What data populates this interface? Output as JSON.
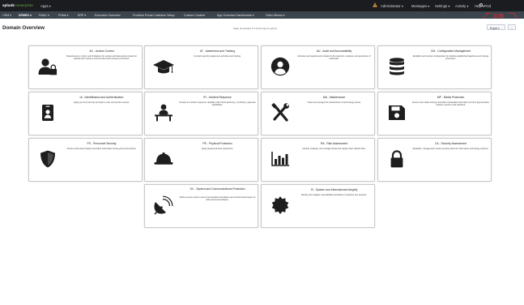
{
  "topbar": {
    "brand": "splunk",
    "brand_sub": ">enterprise",
    "apps": "Apps ▾",
    "administrator": "Administrator ▾",
    "messages": "Messages ▾",
    "settings": "Settings ▾",
    "activity": "Activity ▾",
    "help": "Help ▾",
    "find": "Find"
  },
  "nav": {
    "items": [
      "CRM ▾",
      "DPMRC ▾",
      "FAMC ▾",
      "FDMs ▾",
      "ERP ▾",
      "Executive Overview",
      "Frontline Portal Collection Setup",
      "Custom Content",
      "App Overview Dashboards ▾",
      "Other Menus ▾"
    ],
    "active_index": 1
  },
  "logo_text": "CIE",
  "page": {
    "title": "Domain Overview",
    "note": "Page Generated 9 months ago by admin",
    "export": "Export ▾",
    "more": "..."
  },
  "panels": [
    {
      "title": "AC - Access Control",
      "desc": "Requirements, control, and limitations for system and data access based on federal and minimum internal rules and business processes.",
      "icon": "user-lock-icon"
    },
    {
      "title": "AT - Awareness and Training",
      "desc": "Conduct security awareness activities and training.",
      "icon": "graduation-cap-icon"
    },
    {
      "title": "AU - Audit and Accountability",
      "desc": "Activities and requirements related to the retention, analysis, and generation of audit data.",
      "icon": "user-circle-icon"
    },
    {
      "title": "CM - Configuration Management",
      "desc": "Establish and monitor configuration by tracking established baselines and change processes.",
      "icon": "database-icon"
    },
    {
      "title": "IA - Identification and Authentication",
      "desc": "Apply per-host security principle to user and service access.",
      "icon": "id-card-icon"
    },
    {
      "title": "IR - Incident Response",
      "desc": "Provide an incident response capability with robust planning, monitoring, response capabilities.",
      "icon": "incident-response-icon"
    },
    {
      "title": "MA - Maintenance",
      "desc": "Track and manage the maintenance of technology assets.",
      "icon": "tools-icon"
    },
    {
      "title": "MP - Media Protection",
      "desc": "Ensure that media storing controlled unclassified information (CUI) is appropriately marked, secured, and sanitized.",
      "icon": "floppy-disk-icon"
    },
    {
      "title": "PS - Personnel Security",
      "desc": "Screen and protect federal controlled information during personnel actions.",
      "icon": "shield-icon"
    },
    {
      "title": "PE - Physical Protection",
      "desc": "Apply physical access restrictions.",
      "icon": "hard-hat-icon"
    },
    {
      "title": "RA - Risk Assessment",
      "desc": "Identify, evaluate, and manage threat and supply chain related risks.",
      "icon": "bar-chart-icon"
    },
    {
      "title": "CA - Security Assessment",
      "desc": "Establish, manage and monitor security plans for information technology systems.",
      "icon": "padlock-icon"
    },
    {
      "title": "SC - System and Communications Protection",
      "desc": "Define secure system and communication boundaries and control transmission of data across boundaries.",
      "icon": "satellite-dish-icon"
    },
    {
      "title": "SI - System and Informational Integrity",
      "desc": "Identify and mitigate vulnerabilities and flaws in networks and systems.",
      "icon": "gear-badge-icon"
    }
  ]
}
